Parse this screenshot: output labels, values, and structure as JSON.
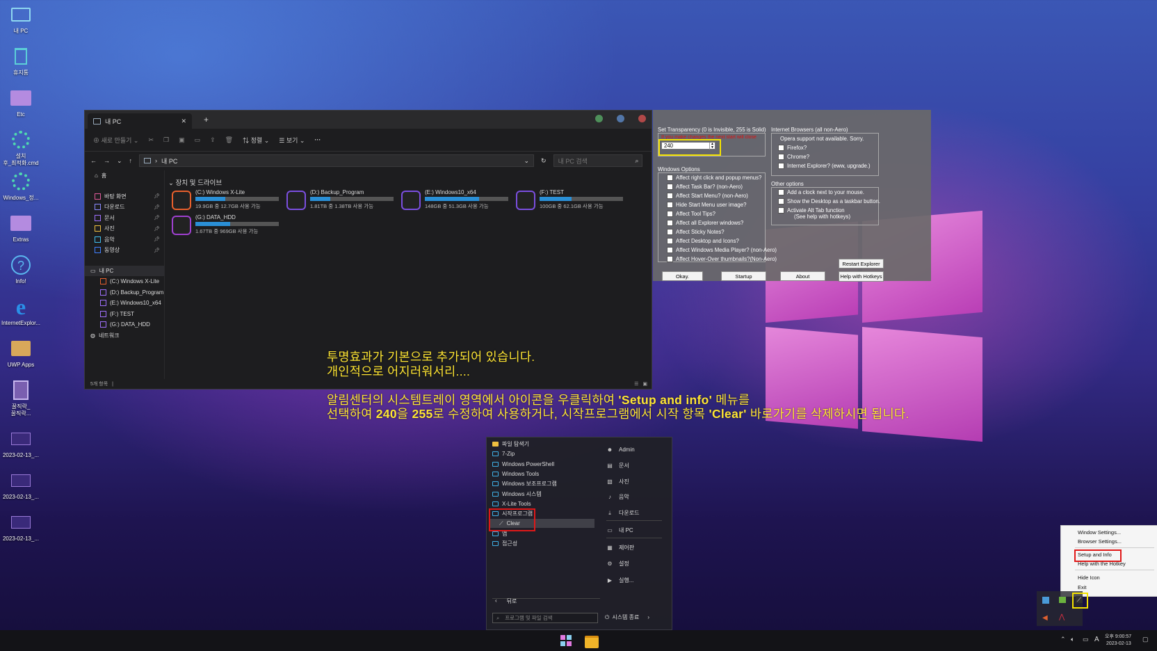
{
  "desktop": {
    "icons": [
      {
        "label": "내 PC",
        "icon": "monitor-icon"
      },
      {
        "label": "휴지통",
        "icon": "recycle-bin-icon"
      },
      {
        "label": "Etc",
        "icon": "folder-icon"
      },
      {
        "label": "설치\n후_최적화.cmd",
        "icon": "gear-icon"
      },
      {
        "label": "Windows_정...",
        "icon": "gear-icon"
      },
      {
        "label": "Extras",
        "icon": "folder-icon"
      },
      {
        "label": "Info!",
        "icon": "help-icon"
      },
      {
        "label": "InternetExplor...",
        "icon": "internet-explorer-icon"
      },
      {
        "label": "UWP Apps",
        "icon": "box-icon"
      },
      {
        "label": "꿀직락_\n꿀직락...",
        "icon": "notepad-icon"
      },
      {
        "label": "2023-02-13_...",
        "icon": "image-file-icon"
      },
      {
        "label": "2023-02-13_...",
        "icon": "image-file-icon"
      },
      {
        "label": "2023-02-13_...",
        "icon": "image-file-icon"
      }
    ]
  },
  "explorer": {
    "tab_title": "내 PC",
    "toolbar": {
      "new_label": "새로 만들기",
      "sort_label": "정렬",
      "view_label": "보기",
      "more_label": "···"
    },
    "address": "내 PC",
    "search_placeholder": "내 PC 검색",
    "nav": {
      "home": "홈",
      "quick": [
        "바탕 화면",
        "다운로드",
        "문서",
        "사진",
        "음악",
        "동영상"
      ],
      "this_pc": "내 PC",
      "drives": [
        "(C:) Windows X-Lite",
        "(D:) Backup_Program",
        "(E:) Windows10_x64",
        "(F:) TEST",
        "(G:) DATA_HDD"
      ],
      "network": "네트워크"
    },
    "section_title": "장치 및 드라이브",
    "drives": [
      {
        "name": "(C:) Windows X-Lite",
        "info": "19.9GB 중 12.7GB 사용 가능",
        "used": 0.36,
        "color": "#e8602c"
      },
      {
        "name": "(D:) Backup_Program",
        "info": "1.81TB 중 1.38TB 사용 가능",
        "used": 0.24,
        "color": "#7b4fe0"
      },
      {
        "name": "(E:) Windows10_x64",
        "info": "148GB 중 51.3GB 사용 가능",
        "used": 0.65,
        "color": "#7b4fe0"
      },
      {
        "name": "(F:) TEST",
        "info": "100GB 중 62.1GB 사용 가능",
        "used": 0.38,
        "color": "#7b4fe0"
      },
      {
        "name": "(G:) DATA_HDD",
        "info": "1.67TB 중 969GB 사용 가능",
        "used": 0.42,
        "color": "#a040d0"
      }
    ],
    "status": "5개 항목"
  },
  "settings": {
    "transparency_label": "Set Transparency (0 is Invisible, 255 is Solid)",
    "transparency_value": "240",
    "red_note": "If you make changes the next start will close",
    "browsers_label": "Internet Browsers (all non-Aero)",
    "opera_note": "Opera support not available. Sorry.",
    "browsers": [
      "Firefox?",
      "Chrome?",
      "Internet Explorer? (eww, upgrade.)"
    ],
    "windows_options_label": "Windows Options",
    "windows_options": [
      "Affect right click and popup menus?",
      "Affect Task Bar? (non-Aero)",
      "Affect Start Menu? (non-Aero)",
      "Hide Start Menu user image?",
      "Affect Tool Tips?",
      "Affect all Explorer windows?",
      "Affect Sticky Notes?",
      "Affect Desktop and Icons?",
      "Affect Windows Media Player? (non-Aero)",
      "Affect Hover-Over thumbnails?(Non-Aero)"
    ],
    "other_options_label": "Other options",
    "other_options": [
      "Add a clock next to your mouse.",
      "Show the Desktop as a taskbar button.",
      "Activate Alt Tab function"
    ],
    "alt_tab_note": "(See help with hotkeys)",
    "restart_button": "Restart  Explorer",
    "buttons": [
      "Okay.",
      "Startup",
      "About",
      "Help with Hotkeys"
    ]
  },
  "overlay": {
    "line1": "투명효과가 기본으로 추가되어 있습니다.",
    "line2": "개인적으로 어지러워서리....",
    "line3a": "알림센터의 시스템트레이 영역에서 아이콘을 우클릭하여 ",
    "line3b": "'Setup and info'",
    "line3c": " 메뉴를",
    "line4a": "선택하여 ",
    "line4b": "240",
    "line4c": "을 ",
    "line4d": "255",
    "line4e": "로 수정하여 사용하거나, 시작프로그램에서 시작 항목 ",
    "line4f": "'Clear'",
    "line4g": " 바로가기를 삭제하시면 됩니다."
  },
  "start_menu": {
    "items": [
      "파일 탐색기",
      "7-Zip",
      "Windows PowerShell",
      "Windows Tools",
      "Windows 보조프로그램",
      "Windows 시스템",
      "X-Lite Tools",
      "시작프로그램",
      "Clear",
      "앱",
      "접근성"
    ],
    "right": [
      "Admin",
      "문서",
      "사진",
      "음악",
      "다운로드",
      "내 PC",
      "제어판",
      "설정",
      "실행..."
    ],
    "back_label": "뒤로",
    "search_placeholder": "프로그램 및 파일 검색",
    "shutdown_label": "시스템 종료"
  },
  "context_menu": {
    "items": [
      "Window Settings...",
      "Browser Settings...",
      "Setup and Info",
      "Help with the Hotkey",
      "Hide Icon",
      "Exit"
    ]
  },
  "taskbar": {
    "time": "오후 9:00:57",
    "date": "2023-02-13",
    "lang": "A"
  }
}
